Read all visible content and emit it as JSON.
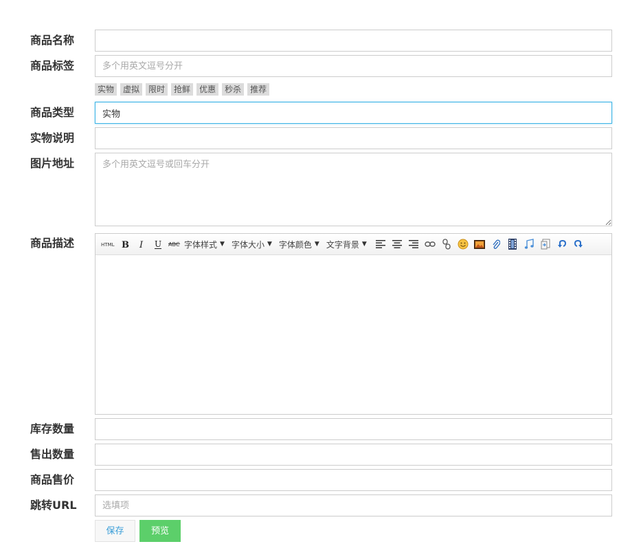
{
  "form": {
    "name": {
      "label": "商品名称",
      "value": "",
      "placeholder": ""
    },
    "tags": {
      "label": "商品标签",
      "value": "",
      "placeholder": "多个用英文逗号分开",
      "quick_tags": [
        "实物",
        "虚拟",
        "限时",
        "抢鲜",
        "优惠",
        "秒杀",
        "推荐"
      ]
    },
    "type": {
      "label": "商品类型",
      "value": "实物"
    },
    "physical_note": {
      "label": "实物说明",
      "value": ""
    },
    "images": {
      "label": "图片地址",
      "value": "",
      "placeholder": "多个用英文逗号或回车分开"
    },
    "description": {
      "label": "商品描述",
      "toolbar": {
        "dropdowns": {
          "font_style": "字体样式",
          "font_size": "字体大小",
          "font_color": "字体颜色",
          "text_bg": "文字背景"
        },
        "icons": [
          "html-icon",
          "bold-icon",
          "italic-icon",
          "underline-icon",
          "strikethrough-icon",
          "align-left-icon",
          "align-center-icon",
          "align-right-icon",
          "link-icon",
          "unlink-icon",
          "emoticon-icon",
          "image-icon",
          "attachment-icon",
          "video-icon",
          "music-icon",
          "insert-code-icon",
          "undo-icon",
          "redo-icon"
        ]
      },
      "content": ""
    },
    "stock": {
      "label": "库存数量",
      "value": ""
    },
    "sold": {
      "label": "售出数量",
      "value": ""
    },
    "price": {
      "label": "商品售价",
      "value": ""
    },
    "redirect_url": {
      "label": "跳转URL",
      "value": "",
      "placeholder": "选填项"
    }
  },
  "actions": {
    "save_label": "保存",
    "preview_label": "预览"
  },
  "colors": {
    "focus_border": "#3db4e6",
    "save_text": "#3a9ed8",
    "preview_bg": "#5ccf6a",
    "tag_bg": "#dcdcdc"
  }
}
